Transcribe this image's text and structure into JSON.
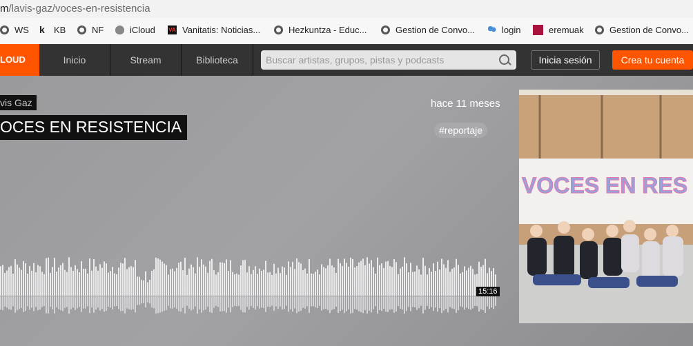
{
  "browser": {
    "url_prefix": "m",
    "url_rest": "/lavis-gaz/voces-en-resistencia",
    "bookmarks": [
      {
        "label": "WS",
        "icon": "globe-icon"
      },
      {
        "label": "KB",
        "icon": "k-icon"
      },
      {
        "label": "NF",
        "icon": "globe-icon"
      },
      {
        "label": "iCloud",
        "icon": "apple-icon"
      },
      {
        "label": "Vanitatis: Noticias...",
        "icon": "va-icon"
      },
      {
        "label": "Hezkuntza - Educ...",
        "icon": "globe-icon"
      },
      {
        "label": "Gestion de Convo...",
        "icon": "globe-icon"
      },
      {
        "label": "login",
        "icon": "people-icon"
      },
      {
        "label": "eremuak",
        "icon": "square-icon"
      },
      {
        "label": "Gestion de Convo...",
        "icon": "globe-icon"
      }
    ]
  },
  "nav": {
    "logo": "LOUD",
    "items": [
      "Inicio",
      "Stream",
      "Biblioteca"
    ],
    "search_placeholder": "Buscar artistas, grupos, pistas y podcasts",
    "signin": "Inicia sesión",
    "create": "Crea tu cuenta"
  },
  "track": {
    "artist": "vis Gaz",
    "title": "OCES EN RESISTENCIA",
    "time_ago": "hace 11 meses",
    "tag": "reportaje",
    "duration": "15:16"
  },
  "artwork": {
    "banner_text": "VOCES EN RES"
  },
  "colors": {
    "brand": "#ff5500",
    "nav_bg": "#333333"
  }
}
